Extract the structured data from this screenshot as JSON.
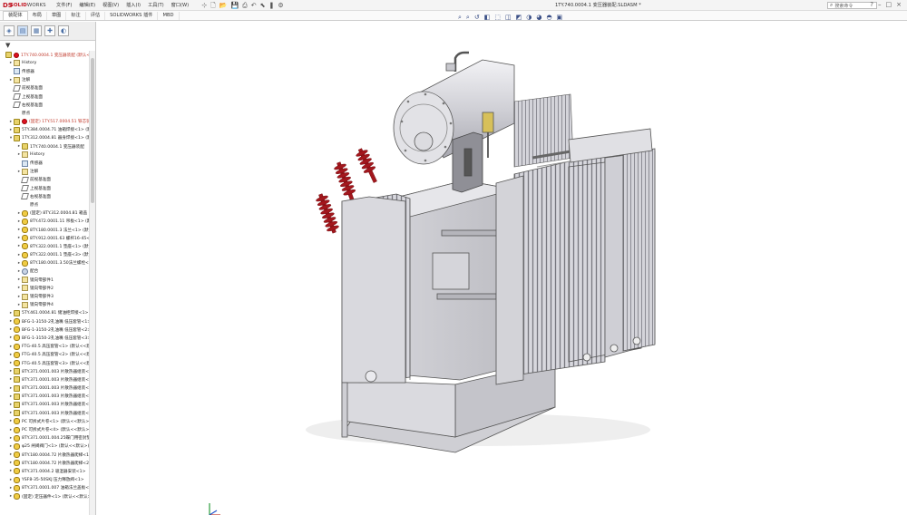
{
  "app": {
    "brand_ds": "DS",
    "brand_a": "SOLID",
    "brand_b": "WORKS",
    "document_title": "1TY.740.0004.1 变压器装配.SLDASM *",
    "search_placeholder": "搜索命令"
  },
  "menu": [
    "文件(F)",
    "编辑(E)",
    "视图(V)",
    "插入(I)",
    "工具(T)",
    "窗口(W)"
  ],
  "quick_icons": [
    "pin-icon",
    "new-icon",
    "open-icon",
    "save-icon",
    "print-icon",
    "undo-icon",
    "select-icon",
    "rebuild-icon",
    "options-icon"
  ],
  "command_tabs": [
    "装配体",
    "布局",
    "草图",
    "标注",
    "评估",
    "SOLIDWORKS 插件",
    "MBD"
  ],
  "hud_icons": [
    "zoom-fit-icon",
    "zoom-area-icon",
    "previous-view-icon",
    "section-view-icon",
    "dynamic-annotation-icon",
    "view-orientation-icon",
    "display-style-icon",
    "hide-show-icon",
    "edit-appearance-icon",
    "apply-scene-icon",
    "view-settings-icon"
  ],
  "panel_tabs": [
    "featuremanager-icon",
    "propertymanager-icon",
    "configurationmanager-icon",
    "dimxpert-icon",
    "display-manager-icon"
  ],
  "tree": [
    {
      "level": 0,
      "arrow": "",
      "icon": "asm",
      "text": "1TY.740.0004.1 变压器装配 (默认<显示状态-1>)",
      "red": true
    },
    {
      "level": 1,
      "arrow": "▸",
      "icon": "folder",
      "text": "History",
      "red": false
    },
    {
      "level": 1,
      "arrow": "",
      "icon": "sensor",
      "text": "传感器",
      "red": false
    },
    {
      "level": 1,
      "arrow": "▸",
      "icon": "folder",
      "text": "注解",
      "red": false
    },
    {
      "level": 1,
      "arrow": "",
      "icon": "plane",
      "text": "前视基准面",
      "red": false
    },
    {
      "level": 1,
      "arrow": "",
      "icon": "plane",
      "text": "上视基准面",
      "red": false
    },
    {
      "level": 1,
      "arrow": "",
      "icon": "plane",
      "text": "右视基准面",
      "red": false
    },
    {
      "level": 1,
      "arrow": "",
      "icon": "origin",
      "text": "原点",
      "red": false
    },
    {
      "level": 1,
      "arrow": "▸",
      "icon": "asm",
      "text": "(固定) 1TY.517.0004.51 铁芯装配<1>",
      "red": true
    },
    {
      "level": 1,
      "arrow": "▸",
      "icon": "asm",
      "text": "5TY.384.0004.71 油箱焊接<1> (默认)",
      "red": false
    },
    {
      "level": 1,
      "arrow": "▾",
      "icon": "asm",
      "text": "1TY.312.0004.81 器身焊接<1> (默认)",
      "red": false
    },
    {
      "level": 2,
      "arrow": "▸",
      "icon": "asm",
      "text": "1TY.740.0004.1 变压器装配",
      "red": false
    },
    {
      "level": 2,
      "arrow": "▸",
      "icon": "folder",
      "text": "History",
      "red": false
    },
    {
      "level": 2,
      "arrow": "",
      "icon": "sensor",
      "text": "传感器",
      "red": false
    },
    {
      "level": 2,
      "arrow": "▸",
      "icon": "folder",
      "text": "注解",
      "red": false
    },
    {
      "level": 2,
      "arrow": "",
      "icon": "plane",
      "text": "前视基准面",
      "red": false
    },
    {
      "level": 2,
      "arrow": "",
      "icon": "plane",
      "text": "上视基准面",
      "red": false
    },
    {
      "level": 2,
      "arrow": "",
      "icon": "plane",
      "text": "右视基准面",
      "red": false
    },
    {
      "level": 2,
      "arrow": "",
      "icon": "origin",
      "text": "原点",
      "red": false
    },
    {
      "level": 2,
      "arrow": "▸",
      "icon": "part",
      "text": "(固定) 8TY.312.0004.81 箱盖",
      "red": false
    },
    {
      "level": 2,
      "arrow": "▸",
      "icon": "part",
      "text": "8TY.472.0001.11 吊板<1> (默认)",
      "red": false
    },
    {
      "level": 2,
      "arrow": "▸",
      "icon": "part",
      "text": "8TY.180.0001.3 法兰<1> (默认)",
      "red": false
    },
    {
      "level": 2,
      "arrow": "▸",
      "icon": "part",
      "text": "8TY.912.0001.63 螺杆16-45<1>",
      "red": false
    },
    {
      "level": 2,
      "arrow": "▸",
      "icon": "part",
      "text": "8TY.322.0001.1 垫座<1> (默认)",
      "red": false
    },
    {
      "level": 2,
      "arrow": "▸",
      "icon": "part",
      "text": "8TY.322.0001.1 垫座<3> (默认)",
      "red": false
    },
    {
      "level": 2,
      "arrow": "▸",
      "icon": "part",
      "text": "8TY.180.0001.3.50法兰螺栓<1>",
      "red": false
    },
    {
      "level": 2,
      "arrow": "▸",
      "icon": "mate",
      "text": "配合",
      "red": false
    },
    {
      "level": 2,
      "arrow": "▸",
      "icon": "folder",
      "text": "镜向零部件1",
      "red": false
    },
    {
      "level": 2,
      "arrow": "▸",
      "icon": "folder",
      "text": "镜向零部件2",
      "red": false
    },
    {
      "level": 2,
      "arrow": "▸",
      "icon": "folder",
      "text": "镜向零部件3",
      "red": false
    },
    {
      "level": 2,
      "arrow": "▸",
      "icon": "folder",
      "text": "镜向零部件4",
      "red": false
    },
    {
      "level": 1,
      "arrow": "▸",
      "icon": "asm",
      "text": "5TY.461.0004.81 储油柜焊接<1> (默认)",
      "red": false
    },
    {
      "level": 1,
      "arrow": "▸",
      "icon": "part",
      "text": "BFG-1-3150-2孔油嘴 低压套管<1>",
      "red": false
    },
    {
      "level": 1,
      "arrow": "▸",
      "icon": "part",
      "text": "BFG-1-3150-2孔油嘴 低压套管<2>",
      "red": false
    },
    {
      "level": 1,
      "arrow": "▸",
      "icon": "part",
      "text": "BFG-1-3150-2孔油嘴 低压套管<3>",
      "red": false
    },
    {
      "level": 1,
      "arrow": "▸",
      "icon": "part",
      "text": "FTG-40.5 高压套管<1> (默认<<默认>)",
      "red": false
    },
    {
      "level": 1,
      "arrow": "▸",
      "icon": "part",
      "text": "FTG-40.5 高压套管<2> (默认<<默认>)",
      "red": false
    },
    {
      "level": 1,
      "arrow": "▸",
      "icon": "part",
      "text": "FTG-40.5 高压套管<3> (默认<<默认>)",
      "red": false
    },
    {
      "level": 1,
      "arrow": "▸",
      "icon": "asm",
      "text": "8TY.371.0001.003 片散热器组装<1>",
      "red": false
    },
    {
      "level": 1,
      "arrow": "▸",
      "icon": "asm",
      "text": "8TY.371.0001.003 片散热器组装<2>",
      "red": false
    },
    {
      "level": 1,
      "arrow": "▸",
      "icon": "asm",
      "text": "8TY.371.0001.003 片散热器组装<3>",
      "red": false
    },
    {
      "level": 1,
      "arrow": "▸",
      "icon": "asm",
      "text": "8TY.371.0001.003 片散热器组装<4>",
      "red": false
    },
    {
      "level": 1,
      "arrow": "▸",
      "icon": "asm",
      "text": "8TY.371.0001.003 片散热器组装<5>",
      "red": false
    },
    {
      "level": 1,
      "arrow": "▸",
      "icon": "asm",
      "text": "8TY.371.0001.003 片散热器组装<6>",
      "red": false
    },
    {
      "level": 1,
      "arrow": "▸",
      "icon": "part",
      "text": "PC 可拆式片卷<1> (默认<<默认>)",
      "red": false
    },
    {
      "level": 1,
      "arrow": "▸",
      "icon": "part",
      "text": "PC 可拆式片卷<4> (默认<<默认>)",
      "red": false
    },
    {
      "level": 1,
      "arrow": "▸",
      "icon": "part",
      "text": "8TY.371.0001.004.25蝶门用密封垫",
      "red": false
    },
    {
      "level": 1,
      "arrow": "▸",
      "icon": "part",
      "text": "φ25 闸阀阀门<1> (默认<<默认>)",
      "red": false
    },
    {
      "level": 1,
      "arrow": "▸",
      "icon": "part",
      "text": "8TY.180.0004.72 片散热器爬梯<1>",
      "red": false
    },
    {
      "level": 1,
      "arrow": "▸",
      "icon": "part",
      "text": "8TY.180.0004.72 片散热器爬梯<2>",
      "red": false
    },
    {
      "level": 1,
      "arrow": "▸",
      "icon": "part",
      "text": "8TY.371.0004.2 吸湿器安装<1>",
      "red": false
    },
    {
      "level": 1,
      "arrow": "▸",
      "icon": "part",
      "text": "YSF8-35-50SKJ 压力释放阀<1>",
      "red": false
    },
    {
      "level": 1,
      "arrow": "▸",
      "icon": "part",
      "text": "8TY.371.0001.007 油箱法兰盖板<1>",
      "red": false
    },
    {
      "level": 1,
      "arrow": "▸",
      "icon": "part",
      "text": "(固定) 定压器件<1> (默认<<默认>)",
      "red": false
    }
  ]
}
